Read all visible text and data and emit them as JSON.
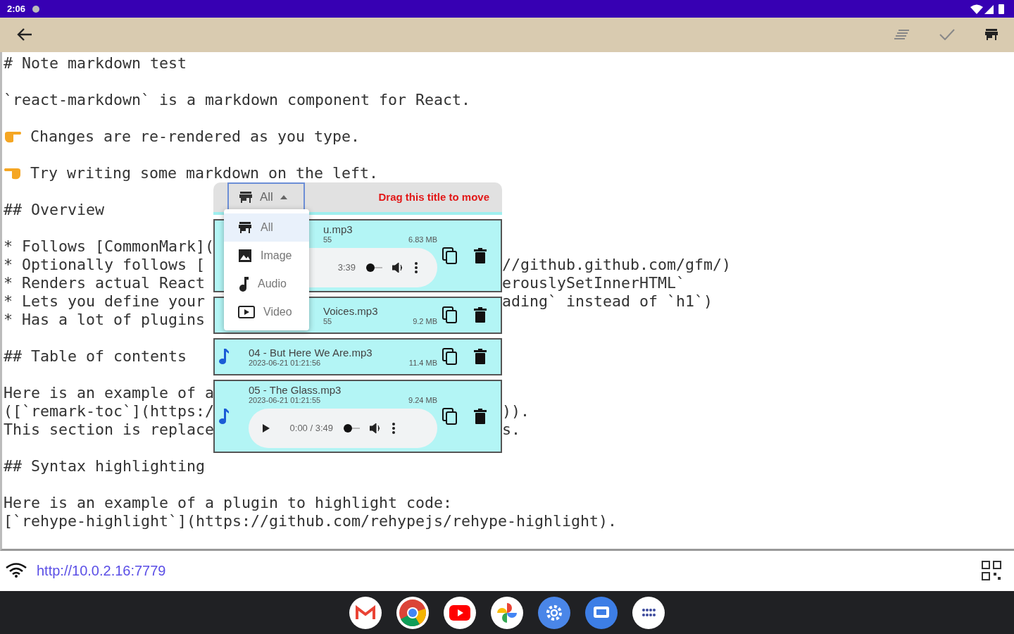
{
  "status_bar": {
    "time": "2:06"
  },
  "editor": {
    "blocks": [
      [
        {
          "kind": "plain",
          "text": "# Note markdown test"
        }
      ],
      [
        {
          "kind": "plain",
          "text": "`react-markdown` is a markdown component for React."
        }
      ],
      [
        {
          "kind": "hand_right",
          "text": "Changes are re-rendered as you type."
        }
      ],
      [
        {
          "kind": "hand_left",
          "text": "Try writing some markdown on the left."
        }
      ],
      [
        {
          "kind": "plain",
          "text": "## Overview"
        }
      ],
      [
        {
          "kind": "plain",
          "text": "* Follows [CommonMark]("
        },
        {
          "kind": "plain",
          "text": "* Optionally follows [",
          "right": "//github.github.com/gfm/)"
        },
        {
          "kind": "plain",
          "text": "* Renders actual React",
          "right": "erouslySetInnerHTML`"
        },
        {
          "kind": "plain",
          "text": "* Lets you define your",
          "right": "ading` instead of `h1`)"
        },
        {
          "kind": "plain",
          "text": "* Has a lot of plugins"
        }
      ],
      [
        {
          "kind": "plain",
          "text": "## Table of contents"
        }
      ],
      [
        {
          "kind": "plain",
          "text": "Here is an example of a"
        },
        {
          "kind": "plain",
          "text": "([`remark-toc`](https:/",
          "right": "))."
        },
        {
          "kind": "plain",
          "text": "This section is replace",
          "right": "s."
        }
      ],
      [
        {
          "kind": "plain",
          "text": "## Syntax highlighting"
        }
      ],
      [
        {
          "kind": "plain",
          "text": "Here is an example of a plugin to highlight code:"
        },
        {
          "kind": "plain",
          "text": "[`rehype-highlight`](https://github.com/rehypejs/rehype-highlight)."
        }
      ]
    ]
  },
  "overlay": {
    "filter": {
      "value": "All",
      "expanded": true
    },
    "hint": "Drag this title to move",
    "menu": [
      {
        "label": "All",
        "kind": "store",
        "selected": true
      },
      {
        "label": "Image",
        "kind": "image",
        "selected": false
      },
      {
        "label": "Audio",
        "kind": "audio",
        "selected": false
      },
      {
        "label": "Video",
        "kind": "video",
        "selected": false
      }
    ],
    "files": [
      {
        "name": "u.mp3",
        "date": "55",
        "size": "6.83 MB",
        "partly_hidden": true,
        "player": {
          "time": "3:39"
        }
      },
      {
        "name": "Voices.mp3",
        "date": "55",
        "size": "9.2 MB",
        "partly_hidden": true
      },
      {
        "name": "04 - But Here We Are.mp3",
        "date": "2023-06-21 01:21:56",
        "size": "11.4 MB",
        "partly_hidden": false
      },
      {
        "name": "05 - The Glass.mp3",
        "date": "2023-06-21 01:21:55",
        "size": "9.24 MB",
        "partly_hidden": false,
        "player": {
          "time": "0:00 / 3:49"
        }
      }
    ]
  },
  "url_bar": {
    "url": "http://10.0.2.16:7779"
  }
}
